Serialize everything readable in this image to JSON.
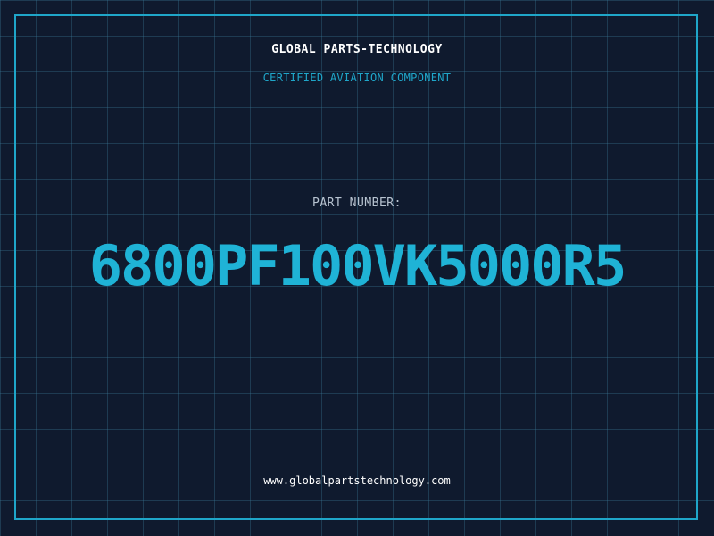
{
  "header": {
    "company": "GLOBAL PARTS-TECHNOLOGY",
    "tagline": "CERTIFIED AVIATION COMPONENT"
  },
  "part": {
    "label": "PART NUMBER:",
    "number": "6800PF100VK5000R5"
  },
  "footer": {
    "website": "www.globalpartstechnology.com"
  },
  "colors": {
    "background": "#0f1a2e",
    "accent": "#1fb3d6",
    "grid": "#2b5d78",
    "text": "#ffffff",
    "muted": "#b7c3d0"
  }
}
